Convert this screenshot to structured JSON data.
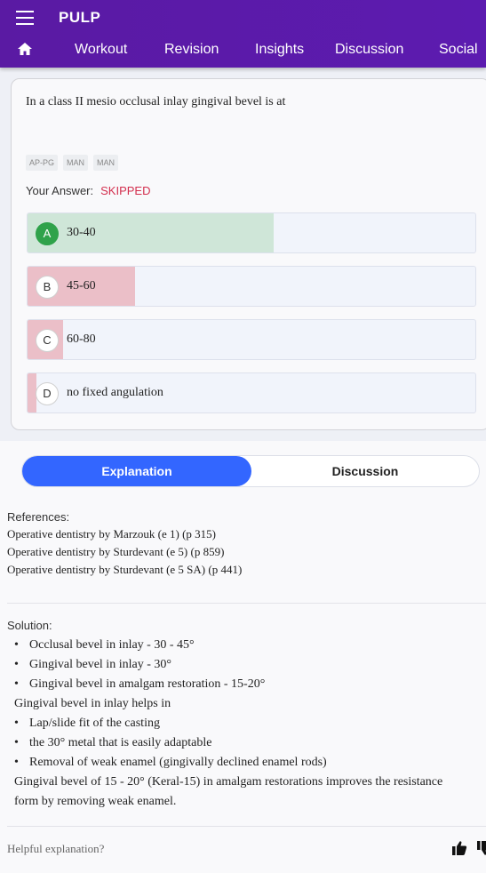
{
  "app": {
    "title": "PULP"
  },
  "nav": {
    "tabs": [
      {
        "label": "Workout"
      },
      {
        "label": "Revision"
      },
      {
        "label": "Insights"
      },
      {
        "label": "Discussion"
      },
      {
        "label": "Social"
      }
    ]
  },
  "question": {
    "text": "In a class II mesio occlusal inlay gingival bevel is at",
    "tags": [
      "AP-PG",
      "MAN",
      "MAN"
    ],
    "your_answer_label": "Your Answer:",
    "your_answer_value": "SKIPPED",
    "options": [
      {
        "letter": "A",
        "text": "30-40",
        "percent": 55,
        "correct": true
      },
      {
        "letter": "B",
        "text": "45-60",
        "percent": 24,
        "correct": false
      },
      {
        "letter": "C",
        "text": "60-80",
        "percent": 8,
        "correct": false
      },
      {
        "letter": "D",
        "text": "no fixed angulation",
        "percent": 2,
        "correct": false
      }
    ]
  },
  "toggle": {
    "explanation": "Explanation",
    "discussion": "Discussion"
  },
  "references": {
    "heading": "References:",
    "items": [
      "Operative dentistry by Marzouk (e 1) (p 315)",
      "Operative dentistry by Sturdevant (e 5) (p 859)",
      "Operative dentistry by Sturdevant (e 5 SA) (p 441)"
    ]
  },
  "solution": {
    "heading": "Solution:",
    "b1": "Occlusal bevel in inlay - 30 - 45°",
    "b2": "Gingival bevel in inlay - 30°",
    "b3": "Gingival bevel in amalgam restoration - 15-20°",
    "p1": "Gingival bevel in inlay helps in",
    "b4": "Lap/slide fit of the casting",
    "b5": "the 30° metal that is easily adaptable",
    "b6": "Removal of weak enamel (gingivally declined enamel rods)",
    "p2a": "Gingival bevel of 15 - 20° (Keral-15) in amalgam restorations improves the resistance",
    "p2b": "form by removing weak enamel."
  },
  "feedback": {
    "prompt": "Helpful explanation?"
  },
  "colors": {
    "appbar": "#5a1aa3",
    "correct_fill": "#cfe6d8",
    "wrong_fill": "#ebbfc8",
    "accent": "#3366ff",
    "skipped": "#d32f4e"
  },
  "icons": [
    "menu-icon",
    "home-icon",
    "thumbs-up-icon",
    "thumbs-down-icon"
  ]
}
